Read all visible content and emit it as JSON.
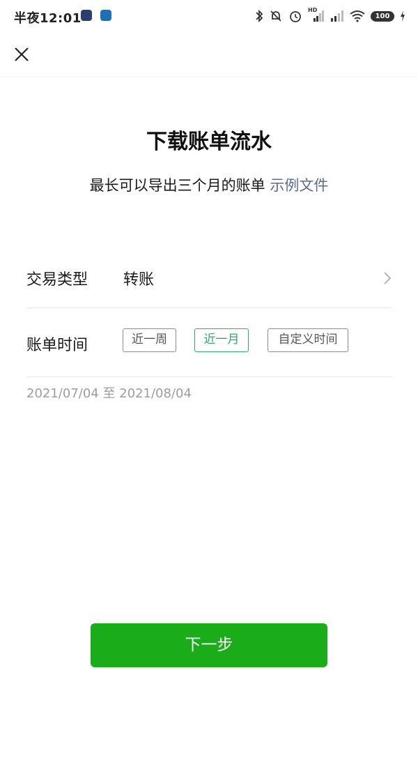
{
  "status_bar": {
    "time": "半夜12:01",
    "hd_label": "HD",
    "battery": "100"
  },
  "header": {
    "title": "下载账单流水",
    "subtitle": "最长可以导出三个月的账单",
    "sample_link": "示例文件"
  },
  "form": {
    "transaction_type_label": "交易类型",
    "transaction_type_value": "转账",
    "bill_time_label": "账单时间",
    "time_options": [
      "近一周",
      "近一月",
      "自定义时间"
    ],
    "selected_option": "近一月",
    "date_range": "2021/07/04 至 2021/08/04"
  },
  "next_button": "下一步",
  "colors": {
    "brand_green": "#1aad19",
    "active_chip": "#2aae67",
    "link": "#5b6b8c"
  }
}
